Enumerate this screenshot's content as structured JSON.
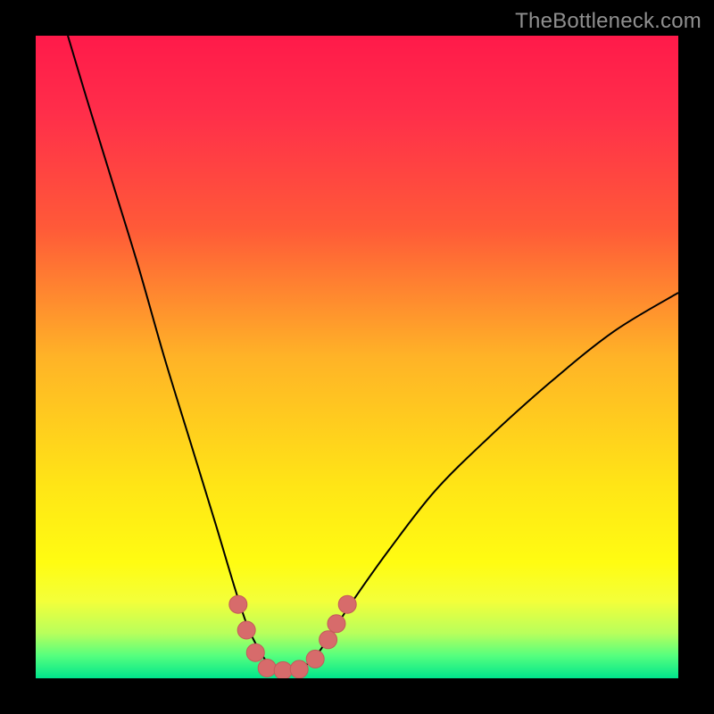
{
  "watermark": "TheBottleneck.com",
  "colors": {
    "frame": "#000000",
    "watermark": "#8f8f8f",
    "gradient_stops": [
      {
        "offset": 0.0,
        "color": "#ff1a4a"
      },
      {
        "offset": 0.12,
        "color": "#ff2e4a"
      },
      {
        "offset": 0.3,
        "color": "#ff5a38"
      },
      {
        "offset": 0.5,
        "color": "#ffb327"
      },
      {
        "offset": 0.7,
        "color": "#ffe516"
      },
      {
        "offset": 0.82,
        "color": "#fffc12"
      },
      {
        "offset": 0.88,
        "color": "#f3ff3a"
      },
      {
        "offset": 0.93,
        "color": "#b8ff5c"
      },
      {
        "offset": 0.965,
        "color": "#55ff7e"
      },
      {
        "offset": 1.0,
        "color": "#00e58c"
      }
    ],
    "curve_stroke": "#000000",
    "marker_fill": "#d76b6b",
    "marker_stroke": "#c45a5a"
  },
  "chart_data": {
    "type": "line",
    "title": "",
    "xlabel": "",
    "ylabel": "",
    "xlim": [
      0,
      100
    ],
    "ylim": [
      0,
      100
    ],
    "grid": false,
    "legend": false,
    "series": [
      {
        "name": "bottleneck_curve",
        "x": [
          5,
          8,
          12,
          16,
          20,
          24,
          28,
          31,
          33,
          35,
          36.5,
          38,
          40,
          42,
          44,
          46,
          50,
          55,
          62,
          70,
          80,
          90,
          100
        ],
        "y": [
          100,
          90,
          77,
          64,
          50,
          37,
          24,
          14,
          8,
          4,
          2,
          1.2,
          1.2,
          2,
          4,
          7,
          13,
          20,
          29,
          37,
          46,
          54,
          60
        ]
      }
    ],
    "markers": [
      {
        "x": 31.5,
        "y": 11.5
      },
      {
        "x": 32.8,
        "y": 7.5
      },
      {
        "x": 34.2,
        "y": 4.0
      },
      {
        "x": 36.0,
        "y": 1.6
      },
      {
        "x": 38.5,
        "y": 1.2
      },
      {
        "x": 41.0,
        "y": 1.4
      },
      {
        "x": 43.5,
        "y": 3.0
      },
      {
        "x": 45.5,
        "y": 6.0
      },
      {
        "x": 46.8,
        "y": 8.5
      },
      {
        "x": 48.5,
        "y": 11.5
      }
    ],
    "annotations": []
  }
}
